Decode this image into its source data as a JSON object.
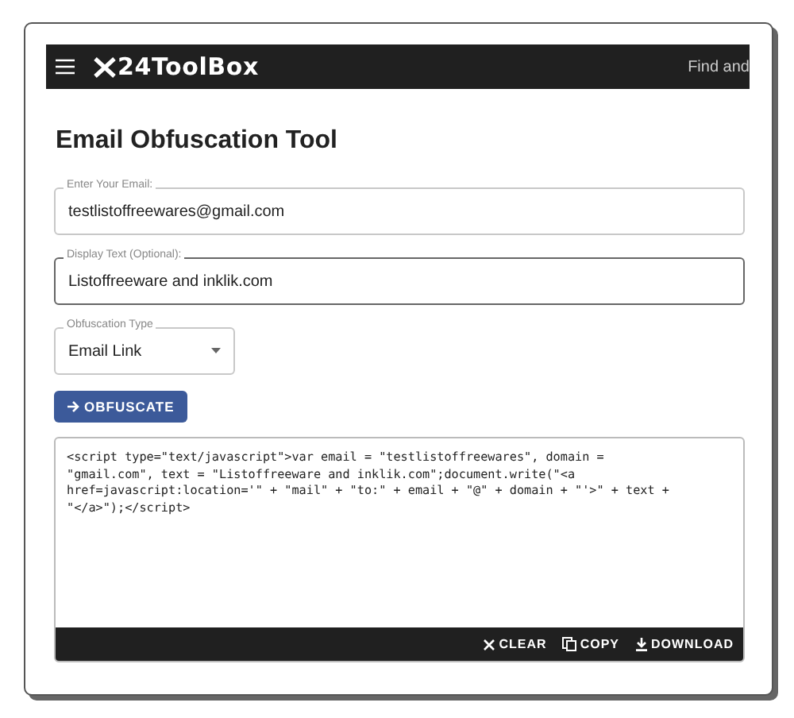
{
  "header": {
    "logo": "24ToolBox",
    "search_hint": "Find and"
  },
  "title": "Email Obfuscation Tool",
  "fields": [
    {
      "kind": "text",
      "label": "Enter Your Email:",
      "value": "testlistoffreewares@gmail.com",
      "focused": false
    },
    {
      "kind": "text",
      "label": "Display Text (Optional):",
      "value": "Listoffreeware and inklik.com",
      "focused": true
    },
    {
      "kind": "select",
      "label": "Obfuscation Type",
      "value": "Email Link",
      "focused": false
    }
  ],
  "obfuscate_button": "OBFUSCATE",
  "output": {
    "lines": [
      "<script type=\"text/javascript\">var email = \"testlistoffreewares\", domain =",
      "\"gmail.com\", text = \"Listoffreeware and inklik.com\";document.write(\"<a",
      "href=javascript:location='\" + \"mail\" + \"to:\" + email + \"@\" + domain + \"'>\" + text +",
      "\"</a>\");</script>"
    ],
    "actions": [
      {
        "kind": "clear",
        "label": "CLEAR"
      },
      {
        "kind": "copy",
        "label": "COPY"
      },
      {
        "kind": "download",
        "label": "DOWNLOAD"
      }
    ]
  }
}
